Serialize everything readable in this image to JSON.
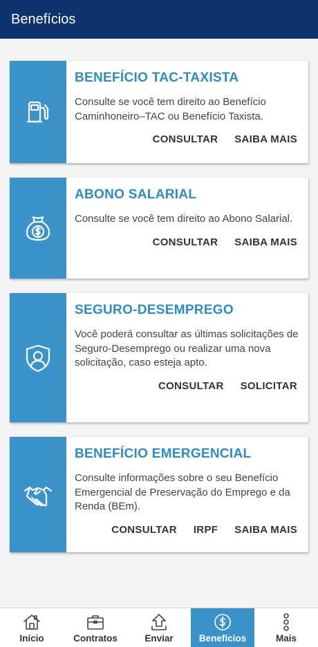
{
  "header": {
    "title": "Benefícios"
  },
  "cards": [
    {
      "icon": "fuel-pump-icon",
      "title": "BENEFÍCIO TAC-TAXISTA",
      "description": "Consulte se você tem direito ao Benefício Caminhoneiro–TAC ou Benefício Taxista.",
      "actions": [
        "CONSULTAR",
        "SAIBA MAIS"
      ]
    },
    {
      "icon": "money-bag-icon",
      "title": "ABONO SALARIAL",
      "description": "Consulte se você tem direito ao Abono Salarial.",
      "actions": [
        "CONSULTAR",
        "SAIBA MAIS"
      ]
    },
    {
      "icon": "shield-person-icon",
      "title": "SEGURO-DESEMPREGO",
      "description": "Você poderá consultar as últimas solicitações de Seguro-Desemprego ou realizar uma nova solicitação, caso esteja apto.",
      "actions": [
        "CONSULTAR",
        "SOLICITAR"
      ]
    },
    {
      "icon": "handshake-icon",
      "title": "BENEFÍCIO EMERGENCIAL",
      "description": "Consulte informações sobre o seu Benefício Emergencial de Preservação do Emprego e da Renda (BEm).",
      "actions": [
        "CONSULTAR",
        "IRPF",
        "SAIBA MAIS"
      ]
    }
  ],
  "bottom_nav": [
    {
      "label": "Início",
      "icon": "house-icon"
    },
    {
      "label": "Contratos",
      "icon": "briefcase-icon"
    },
    {
      "label": "Enviar",
      "icon": "upload-icon"
    },
    {
      "label": "Benefícios",
      "icon": "dollar-circle-icon",
      "active": true
    },
    {
      "label": "Mais",
      "icon": "more-dots-icon"
    }
  ],
  "colors": {
    "header": "#0c326f",
    "accent": "#3b93c9",
    "title": "#2e8bc4"
  }
}
